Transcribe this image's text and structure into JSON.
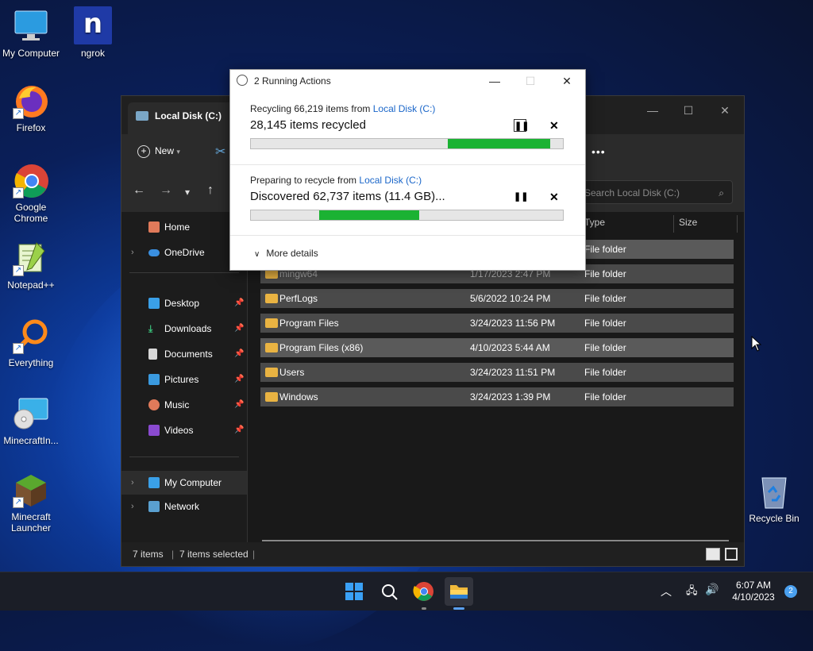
{
  "desktop": {
    "icons": [
      {
        "label": "My Computer"
      },
      {
        "label": "ngrok"
      },
      {
        "label": "Firefox"
      },
      {
        "label": "Google Chrome"
      },
      {
        "label": "Notepad++"
      },
      {
        "label": "Everything"
      },
      {
        "label": "MinecraftIn..."
      },
      {
        "label": "Minecraft Launcher"
      },
      {
        "label": "Recycle Bin"
      }
    ],
    "ngrok_letter": "n"
  },
  "explorer": {
    "tab_title": "Local Disk (C:)",
    "new_label": "New",
    "search_placeholder": "Search Local Disk (C:)",
    "more_label": "•••",
    "sidebar": {
      "home": "Home",
      "onedrive": "OneDrive",
      "desktop": "Desktop",
      "downloads": "Downloads",
      "documents": "Documents",
      "pictures": "Pictures",
      "music": "Music",
      "videos": "Videos",
      "mycomputer": "My Computer",
      "network": "Network"
    },
    "columns": {
      "type": "Type",
      "size": "Size"
    },
    "rows": [
      {
        "name": "",
        "date": "",
        "type": "File folder"
      },
      {
        "name": "mingw64",
        "date": "1/17/2023 2:47 PM",
        "type": "File folder"
      },
      {
        "name": "PerfLogs",
        "date": "5/6/2022 10:24 PM",
        "type": "File folder"
      },
      {
        "name": "Program Files",
        "date": "3/24/2023 11:56 PM",
        "type": "File folder"
      },
      {
        "name": "Program Files (x86)",
        "date": "4/10/2023 5:44 AM",
        "type": "File folder"
      },
      {
        "name": "Users",
        "date": "3/24/2023 11:51 PM",
        "type": "File folder"
      },
      {
        "name": "Windows",
        "date": "3/24/2023 1:39 PM",
        "type": "File folder"
      }
    ],
    "status": {
      "count": "7 items",
      "selected": "7 items selected"
    }
  },
  "dialog": {
    "title": "2 Running Actions",
    "action1": {
      "line_prefix": "Recycling 66,219 items from ",
      "link": "Local Disk (C:)",
      "status": "28,145 items recycled",
      "progress_start": 0.63,
      "progress_end": 0.96
    },
    "action2": {
      "line_prefix": "Preparing to recycle from ",
      "link": "Local Disk (C:)",
      "status": "Discovered 62,737 items (11.4 GB)...",
      "progress_start": 0.22,
      "progress_end": 0.54
    },
    "more_details": "More details"
  },
  "taskbar": {
    "time": "6:07 AM",
    "date": "4/10/2023",
    "notifications": "2"
  },
  "colors": {
    "progress": "#1bb233",
    "link": "#1a66c9",
    "folder": "#e9b342"
  }
}
